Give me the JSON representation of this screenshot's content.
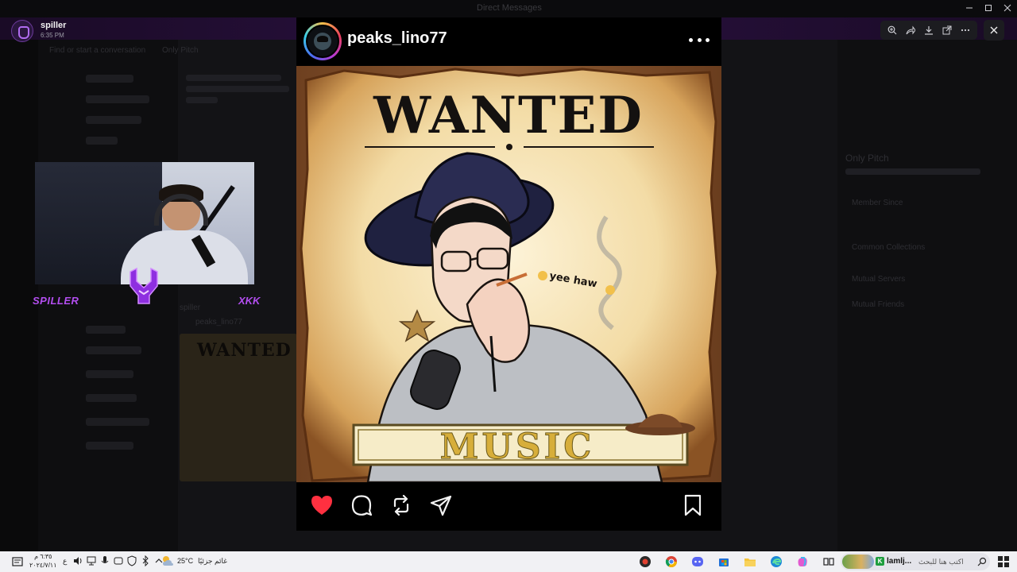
{
  "window": {
    "title": "Direct Messages"
  },
  "stream": {
    "channel_name": "spiller",
    "channel_time": "6:35 PM",
    "cam_label_left": "SPILLER",
    "cam_label_right": "XKK"
  },
  "background": {
    "search_placeholder": "Find or start a conversation",
    "header_user": "Only Pitch",
    "profile_name": "Only Pitch",
    "profile_section_1": "Member Since",
    "profile_section_2": "Common Collections",
    "profile_section_3": "Mutual Servers",
    "profile_section_4": "Mutual Friends",
    "chat_user": "spiller",
    "chat_reply_user": "peaks_lino77",
    "thumb_text": "WANTED"
  },
  "post": {
    "username": "peaks_lino77",
    "image": {
      "headline": "WANTED",
      "speech": "yee haw",
      "footer": "MUSIC"
    },
    "liked": true,
    "colors": {
      "like": "#ff3040"
    }
  },
  "viewer_toolbar": {
    "icons": [
      "zoom-in-icon",
      "share-icon",
      "download-icon",
      "open-external-icon",
      "more-icon"
    ]
  },
  "taskbar": {
    "time": "٦:٣٥ م",
    "date": "٢٠٢٤/٧/١١",
    "lang": "ع",
    "weather_temp": "25°C",
    "weather_desc": "غائم جزئيًا",
    "search_label": "lamlj...",
    "search_hint": "اكتب هنا للبحث",
    "apps": [
      "app-red-icon",
      "chrome-icon",
      "discord-icon",
      "store-icon",
      "file-explorer-icon",
      "edge-icon",
      "copilot-icon",
      "task-view-icon"
    ]
  }
}
